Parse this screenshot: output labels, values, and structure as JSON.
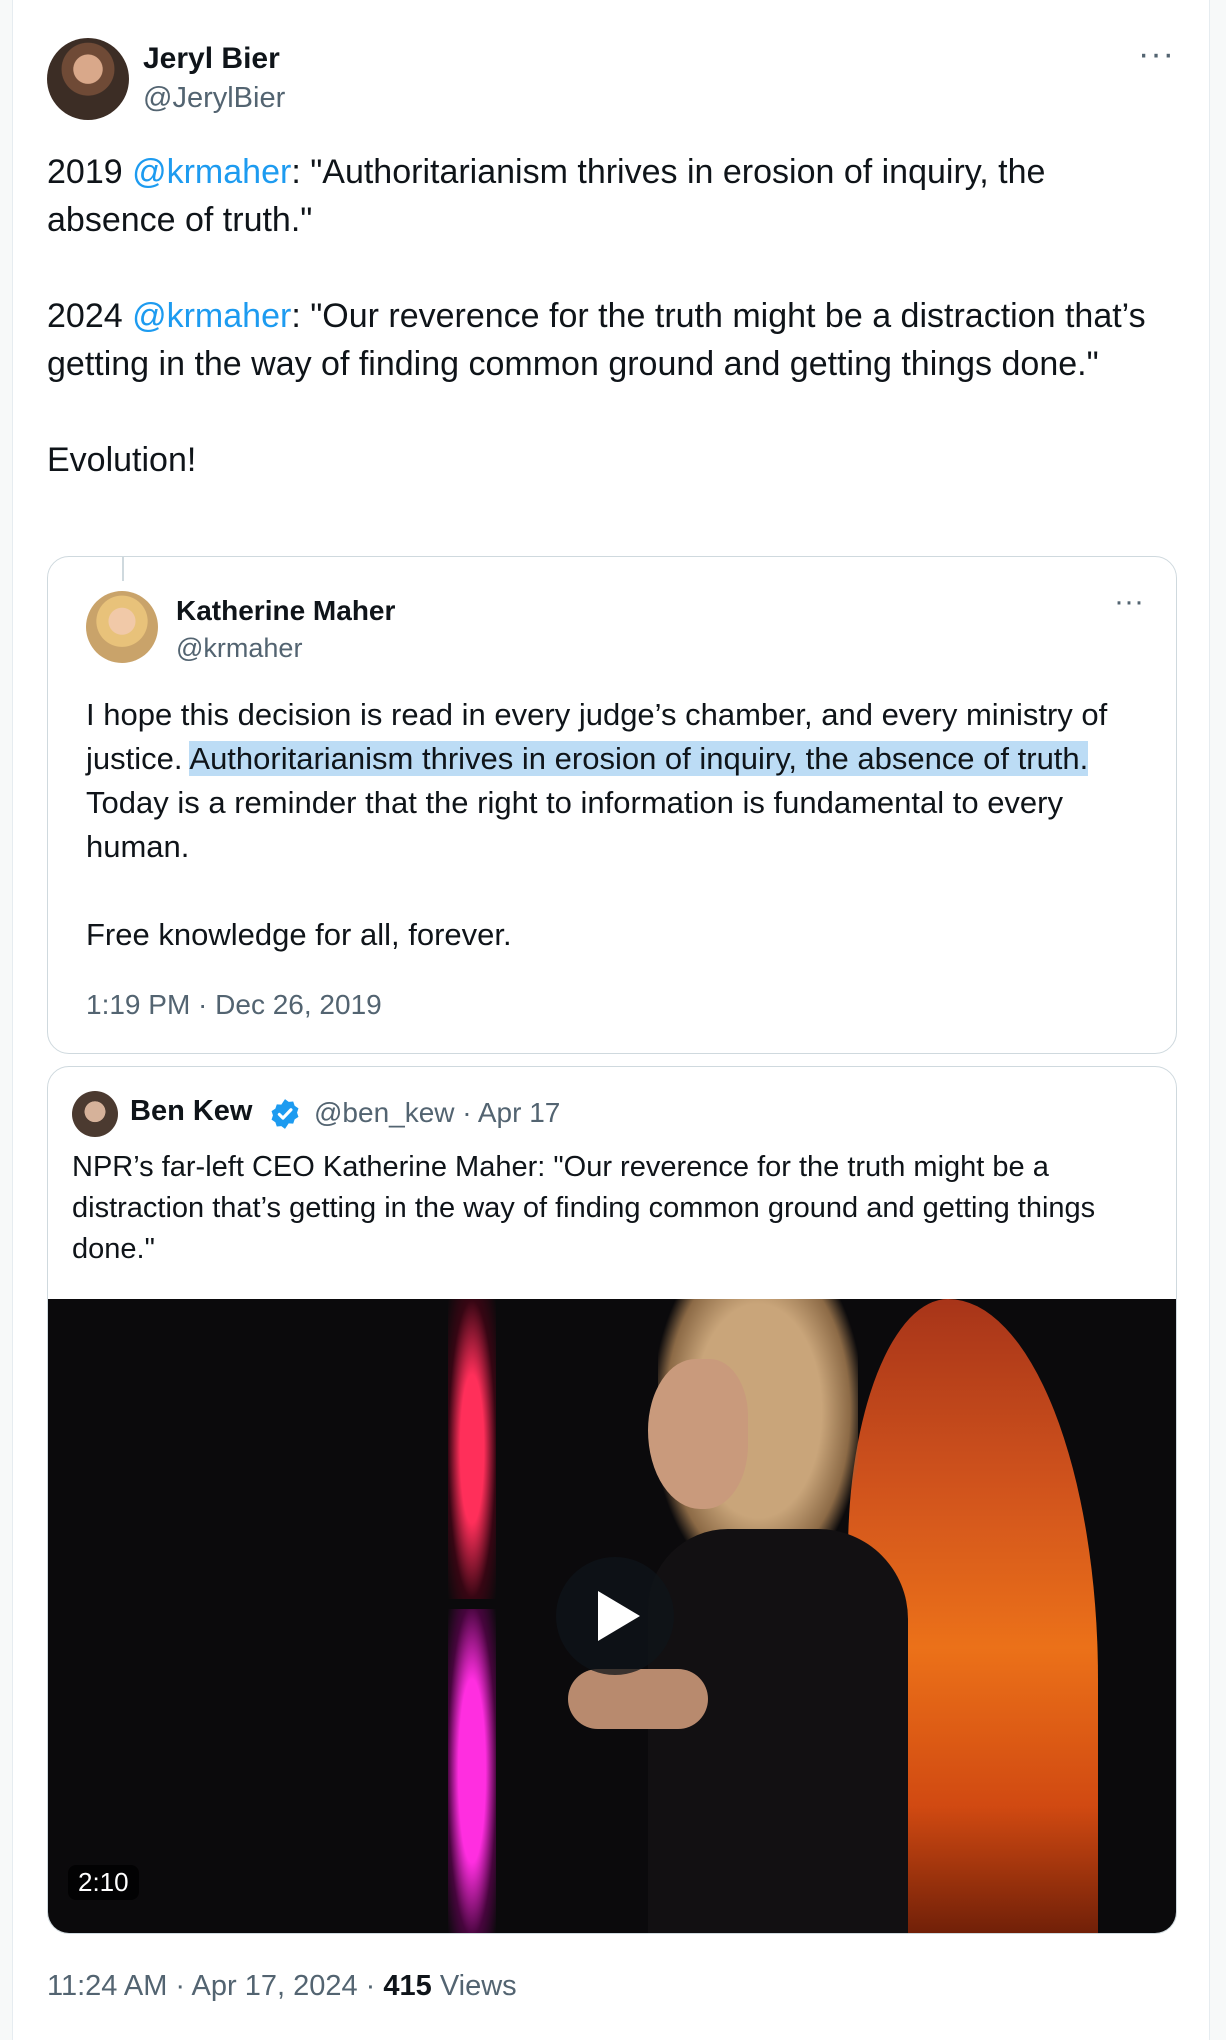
{
  "tweet": {
    "author_name": "Jeryl Bier",
    "author_handle": "@JerylBier",
    "more_icon": "···",
    "text_parts": {
      "p1_year": "2019 ",
      "p1_mention": "@krmaher",
      "p1_text": ": \"Authoritarianism thrives in erosion of inquiry, the absence of truth.\"",
      "p2_year": "2024 ",
      "p2_mention": "@krmaher",
      "p2_text": ": \"Our reverence for the truth might be a distraction that’s getting in the way of finding common ground and getting things done.\"",
      "p3_text": "Evolution!"
    },
    "timestamp": "11:24 AM · Apr 17, 2024 · ",
    "views_count": "415",
    "views_label": " Views"
  },
  "quote1": {
    "author_name": "Katherine Maher",
    "author_handle": "@krmaher",
    "more_icon": "···",
    "text_before": "I hope this decision is read in every judge’s chamber, and every ministry of justice. ",
    "text_highlight": "Authoritarianism thrives in erosion of inquiry, the absence of truth.",
    "text_after": " Today is a reminder that the right to information is fundamental to every human.",
    "text_p2": "Free knowledge for all, forever.",
    "timestamp": "1:19 PM · Dec 26, 2019"
  },
  "quote2": {
    "author_name": "Ben Kew",
    "verified_icon": "verified-badge-icon",
    "meta": "@ben_kew · Apr 17",
    "text": "NPR’s far-left CEO Katherine Maher: \"Our reverence for the truth might be a distraction that’s getting in the way of finding common ground and getting things done.\"",
    "video_duration": "2:10",
    "play_icon": "play-icon"
  },
  "colors": {
    "link": "#1d9bf0",
    "secondary_text": "#536471",
    "highlight": "#bcdcf5",
    "border": "#cfd9de"
  }
}
